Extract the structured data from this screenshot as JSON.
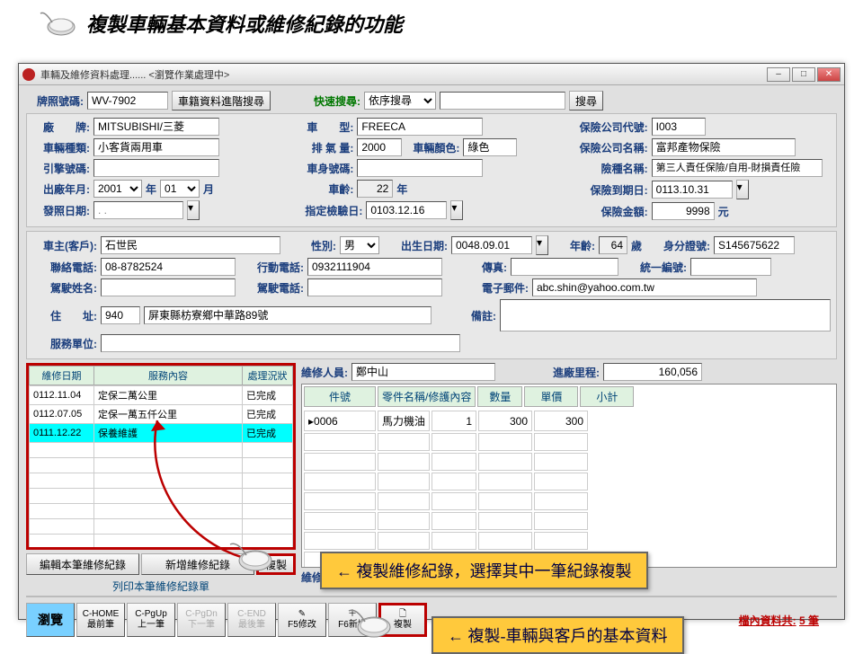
{
  "title": "複製車輛基本資料或維修紀錄的功能",
  "window_title": "車輛及維修資料處理...... <瀏覽作業處理中>",
  "top": {
    "plate_label": "牌照號碼:",
    "plate": "WV-7902",
    "adv_search_btn": "車籍資料進階搜尋",
    "quick_label": "快速搜尋:",
    "quick_mode": "依序搜尋",
    "search_btn": "搜尋"
  },
  "vehicle": {
    "brand_label": "廠　　牌:",
    "brand": "MITSUBISHI/三菱",
    "model_label": "車　　型:",
    "model": "FREECA",
    "type_label": "車輛種類:",
    "type": "小客貨兩用車",
    "cc_label": "排 氣 量:",
    "cc": "2000",
    "color_label": "車輛顏色:",
    "color": "綠色",
    "engine_label": "引擎號碼:",
    "body_label": "車身號碼:",
    "mfg_label": "出廠年月:",
    "year": "2001",
    "year_u": "年",
    "month": "01",
    "month_u": "月",
    "age_label": "車齡:",
    "age": "22",
    "age_u": "年",
    "invoice_label": "發照日期:",
    "invoice_date": "   .  .  ",
    "insp_label": "指定檢驗日:",
    "insp_date": "0103.12.16"
  },
  "ins": {
    "code_label": "保險公司代號:",
    "code": "I003",
    "name_label": "保險公司名稱:",
    "name": "富邦產物保險",
    "type_label": "險種名稱:",
    "type": "第三人責任保險/自用-財損責任險",
    "exp_label": "保險到期日:",
    "exp": "0113.10.31",
    "amt_label": "保險金額:",
    "amt": "9998",
    "amt_u": "元"
  },
  "owner": {
    "label": "車主(客戶):",
    "name": "石世民",
    "sex_label": "性別:",
    "sex": "男",
    "dob_label": "出生日期:",
    "dob": "0048.09.01",
    "age_label": "年齡:",
    "age": "64",
    "age_u": "歲",
    "id_label": "身分證號:",
    "id": "S145675622",
    "tel_label": "聯絡電話:",
    "tel": "08-8782524",
    "mob_label": "行動電話:",
    "mob": "0932111904",
    "fax_label": "傳真:",
    "tax_label": "統一編號:",
    "driver_label": "駕駛姓名:",
    "driver_tel_label": "駕駛電話:",
    "email_label": "電子郵件:",
    "email": "abc.shin@yahoo.com.tw",
    "addr_label": "住　　址:",
    "zip": "940",
    "addr": "屏東縣枋寮鄉中華路89號",
    "remark_label": "備註:",
    "svc_label": "服務單位:"
  },
  "records": {
    "cols": [
      "維修日期",
      "服務內容",
      "處理況狀"
    ],
    "rows": [
      {
        "date": "0112.11.04",
        "svc": "定保二萬公里",
        "stat": "已完成"
      },
      {
        "date": "0112.07.05",
        "svc": "定保一萬五仟公里",
        "stat": "已完成"
      },
      {
        "date": "0111.12.22",
        "svc": "保養維護",
        "stat": "已完成"
      }
    ],
    "btns": {
      "edit": "編輯本筆維修紀錄",
      "add": "新增維修紀錄",
      "copy": "複製"
    },
    "print": "列印本筆維修紀錄單"
  },
  "maint": {
    "tech_label": "維修人員:",
    "tech": "鄭中山",
    "mile_label": "進廠里程:",
    "mile": "160,056",
    "cols": [
      "件號",
      "零件名稱/修護內容",
      "數量",
      "單價",
      "小計"
    ],
    "rows": [
      {
        "pn": "0006",
        "name": "馬力機油",
        "qty": "1",
        "up": "300",
        "sub": "300"
      }
    ],
    "footer_label": "維修備註:"
  },
  "nav": {
    "browse": "瀏覽",
    "home_top": "C-HOME",
    "home": "最前筆",
    "pgup_top": "C-PgUp",
    "pgup": "上一筆",
    "pgdn_top": "C-PgDn",
    "pgdn": "下一筆",
    "end_top": "C-END",
    "end": "最後筆",
    "f5": "F5修改",
    "f6": "F6新增",
    "copy": "複製",
    "count_label": "檔內資料共:",
    "count": "5 筆"
  },
  "callout1": "←  複製維修紀錄，選擇其中一筆紀錄複製",
  "callout2": "←  複製-車輛與客戶的基本資料"
}
